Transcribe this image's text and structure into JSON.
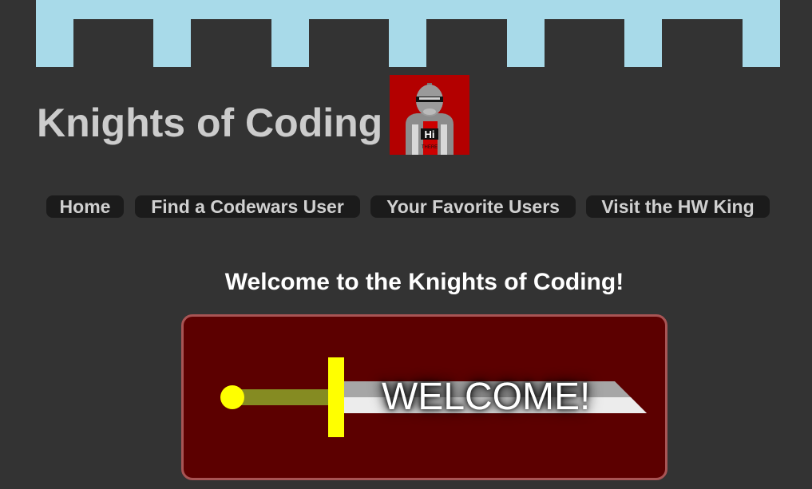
{
  "site": {
    "title": "Knights of Coding",
    "logo_icon": "knight-helmet-icon",
    "logo_shirt_text": "Hi",
    "logo_shirt_subtext": "THERE"
  },
  "nav": {
    "items": [
      {
        "label": "Home"
      },
      {
        "label": "Find a Codewars User"
      },
      {
        "label": "Your Favorite Users"
      },
      {
        "label": "Visit the HW King"
      }
    ]
  },
  "main": {
    "heading": "Welcome to the Knights of Coding!",
    "banner_text": "WELCOME!",
    "banner_icon": "sword-icon"
  },
  "colors": {
    "background": "#333333",
    "battlement": "#a8dae9",
    "banner_bg": "#5c0000",
    "banner_border": "#a85454",
    "logo_bg": "#b30000",
    "sword_guard": "#ffff00",
    "sword_hilt": "#858b22"
  }
}
